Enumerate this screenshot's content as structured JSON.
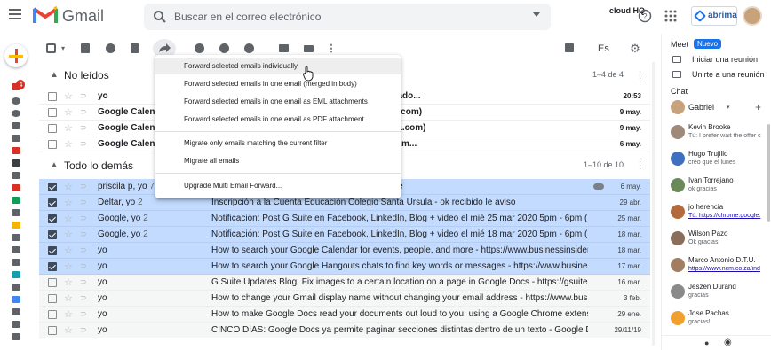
{
  "header": {
    "app_name": "Gmail",
    "search_placeholder": "Buscar en el correo electrónico",
    "hq_label": "cloud HQ",
    "brand_label": "abrima"
  },
  "toolbar": {
    "language": "Es"
  },
  "sections": {
    "unread": {
      "title": "No leídos",
      "count": "1–4 de 4"
    },
    "other": {
      "title": "Todo lo demás",
      "count": "1–10 de 10"
    }
  },
  "unread_rows": [
    {
      "sender": "yo",
      "subject": "artner +51 994080932 www.abrima.com Enviado...",
      "date": "20:53"
    },
    {
      "sender": "Google Calendar",
      "subject": "20 12pm - 1pm (PET) (gmarticorena@abrima.com)",
      "date": "9 may."
    },
    {
      "sender": "Google Calendar",
      "subject": "20 11am - 12pm (PET) (gmarticorena@abrima.com)",
      "date": "9 may."
    },
    {
      "sender": "Google Calendar",
      "subject": "o (2 quincenas) y qui... el mié 6 may 2020 11am...",
      "date": "6 may."
    }
  ],
  "other_rows": [
    {
      "sender": "priscila p, yo",
      "count": "7",
      "subject": "io de US$ 1000 y de US$ 300 (ver adjuntos) que",
      "date": "6 may.",
      "selected": true
    },
    {
      "sender": "Deltar, yo",
      "count": "2",
      "subject": "Inscripción a la Cuenta Educación Colegio Santa Ursula - ok recibido le aviso",
      "date": "29 abr.",
      "selected": true
    },
    {
      "sender": "Google, yo",
      "count": "2",
      "subject": "Notificación: Post G Suite en Facebook, LinkedIn, Blog + video el mié 25 mar 2020 5pm - 6pm (PET) (gmar",
      "date": "25 mar.",
      "selected": true
    },
    {
      "sender": "Google, yo",
      "count": "2",
      "subject": "Notificación: Post G Suite en Facebook, LinkedIn, Blog + video el mié 18 mar 2020 5pm - 6pm (PET) (gmar",
      "date": "18 mar.",
      "selected": true
    },
    {
      "sender": "yo",
      "count": "",
      "subject": "How to search your Google Calendar for events, people, and more - https://www.businessinsider.com/",
      "date": "18 mar.",
      "selected": true
    },
    {
      "sender": "yo",
      "count": "",
      "subject": "How to search your Google Hangouts chats to find key words or messages - https://www.businessinsi",
      "date": "17 mar.",
      "selected": true
    },
    {
      "sender": "yo",
      "count": "",
      "subject": "G Suite Updates Blog: Fix images to a certain location on a page in Google Docs - https://gsuiteupdate",
      "date": "16 mar.",
      "selected": false
    },
    {
      "sender": "yo",
      "count": "",
      "subject": "How to change your Gmail display name without changing your email address - https://www.businessi",
      "date": "3 feb.",
      "selected": false
    },
    {
      "sender": "yo",
      "count": "",
      "subject": "How to make Google Docs read your documents out loud to you, using a Google Chrome extension - h",
      "date": "29 ene.",
      "selected": false
    },
    {
      "sender": "yo",
      "count": "",
      "subject": "CINCO DÍAS: Google Docs ya permite paginar secciones distintas dentro de un texto - Google Docs ya",
      "date": "29/11/19",
      "selected": false
    }
  ],
  "forward_menu": {
    "items": [
      "Forward selected emails individually",
      "Forward selected emails in one email (merged in body)",
      "Forward selected emails in one email as EML attachments",
      "Forward selected emails in one email as PDF attachment",
      "Migrate only emails matching the current filter",
      "Migrate all emails",
      "Upgrade Multi Email Forward..."
    ]
  },
  "right_panel": {
    "meet_title": "Meet",
    "meet_badge": "Nuevo",
    "meet_start": "Iniciar una reunión",
    "meet_join": "Unirte a una reunión",
    "chat_title": "Chat",
    "user_name": "Gabriel",
    "contacts": [
      {
        "name": "Kevin Brooke",
        "status": "Tú: I prefer wait the offer c",
        "color": "#9e8a7a",
        "link": false
      },
      {
        "name": "Hugo Trujillo",
        "status": "creo que el lunes",
        "color": "#3f6fbf",
        "link": false
      },
      {
        "name": "Ivan Torrejano",
        "status": "ok gracias",
        "color": "#6a8a5a",
        "link": false
      },
      {
        "name": "jo herencia",
        "status": "Tú: https://chrome.google.",
        "color": "#b36b3e",
        "link": true
      },
      {
        "name": "Wilson Pazo",
        "status": "Ok gracias",
        "color": "#8a6d5b",
        "link": false
      },
      {
        "name": "Marco Antonio D.T.U.",
        "status": "https://www.ncm.co.za/ind",
        "color": "#a07d63",
        "link": true
      },
      {
        "name": "Jeszén Durand",
        "status": "gracias",
        "color": "#8a8a8a",
        "link": false
      },
      {
        "name": "Jose Pachas",
        "status": "gracias!",
        "color": "#f0a030",
        "link": false
      }
    ]
  }
}
